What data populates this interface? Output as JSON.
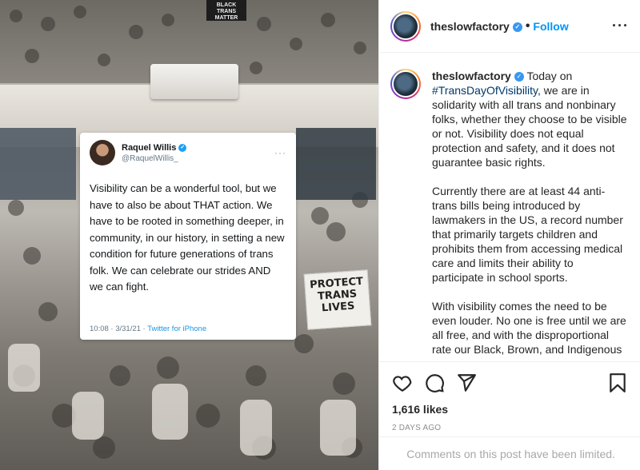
{
  "tweet": {
    "name": "Raquel Willis",
    "handle": "@RaquelWillis_",
    "text": "Visibility can be a wonderful tool, but we have to also be about THAT action. We have to be rooted in something deeper, in community, in our history, in setting a new condition for future generations of trans folk. We can celebrate our strides AND we can fight.",
    "timestamp": "10:08 · 3/31/21 ·",
    "source": "Twitter for iPhone"
  },
  "photo_signs": {
    "main": "PROTECT TRANS LIVES",
    "top": "BLACK TRANS MATTER"
  },
  "header": {
    "username": "theslowfactory",
    "separator": "•",
    "follow_label": "Follow",
    "more_icon": "more-icon"
  },
  "caption": {
    "username": "theslowfactory",
    "lead": "Today on",
    "hashtag": "#TransDayOfVisibility",
    "p1_rest": ", we are in solidarity with all trans and nonbinary folks, whether they choose to be visible or not. Visibility does not equal protection and safety, and it does not guarantee basic rights.",
    "p2": "Currently there are at least 44 anti-trans bills being introduced by lawmakers in the US, a record number that primarily targets children and prohibits them from accessing medical care and limits their ability to participate in school sports.",
    "p3": "With visibility comes the need to be even louder. No one is free until we are all free, and with the disproportional rate our Black, Brown, and Indigenous trans siblings face..."
  },
  "actions": {
    "likes": "1,616 likes",
    "date": "2 DAYS AGO"
  },
  "footer": {
    "text": "Comments on this post have been limited."
  },
  "colors": {
    "accent": "#0095f6",
    "verified": "#3897f0",
    "hashtag": "#00376b",
    "twitter_blue": "#1da1f2"
  }
}
